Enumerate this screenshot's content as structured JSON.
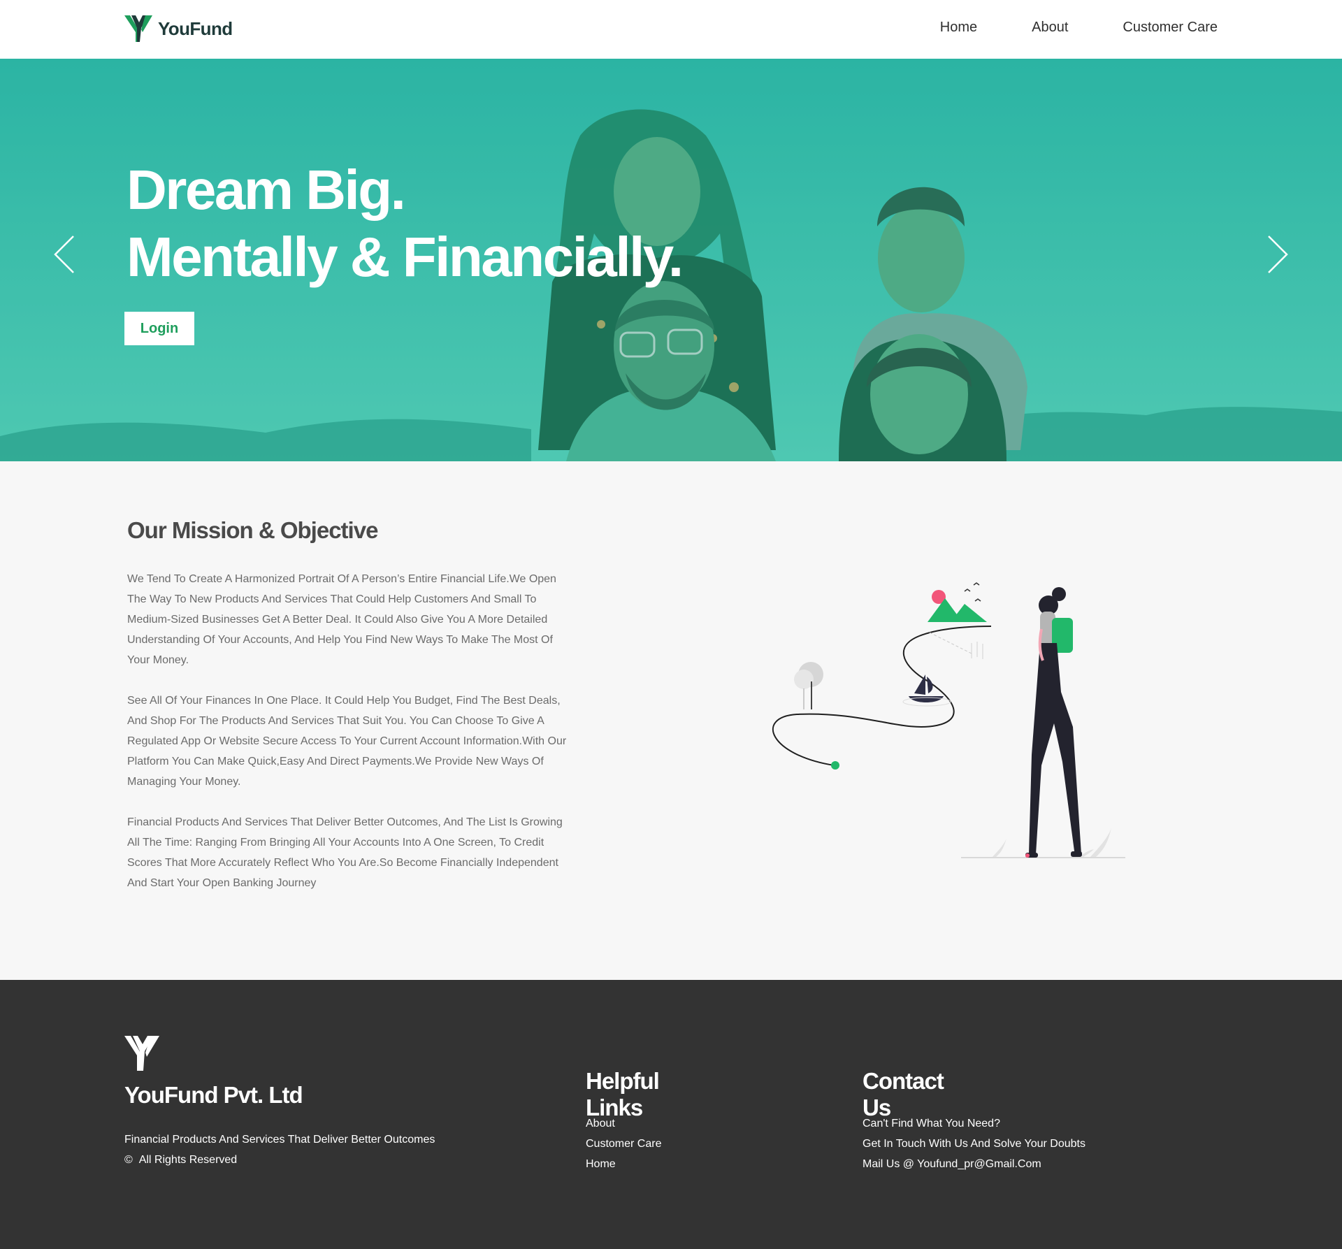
{
  "header": {
    "brand": "YouFund",
    "nav": [
      "Home",
      "About",
      "Customer Care"
    ]
  },
  "hero": {
    "title_line1": "Dream Big.",
    "title_line2": "Mentally & Financially.",
    "login_label": "Login",
    "prev_icon": "chevron-left-icon",
    "next_icon": "chevron-right-icon"
  },
  "mission": {
    "title": "Our Mission & Objective",
    "paragraphs": [
      "We Tend To Create A Harmonized Portrait Of A Person’s Entire Financial Life.We Open The Way To New Products And Services That Could Help Customers And Small To Medium-Sized Businesses Get A Better Deal. It Could Also Give You A More Detailed Understanding Of Your Accounts, And Help You Find New Ways To Make The Most Of Your Money.",
      "See All Of Your Finances In One Place. It Could Help You Budget, Find The Best Deals, And Shop For The Products And Services That Suit You. You Can Choose To Give A Regulated App Or Website Secure Access To Your Current Account Information.With Our Platform You Can Make Quick,Easy And Direct Payments.We Provide New Ways Of Managing Your Money.",
      "Financial Products And Services That Deliver Better Outcomes, And The List Is Growing All The Time: Ranging From Bringing All Your Accounts Into A One Screen, To Credit Scores That More Accurately Reflect Who You Are.So Become Financially Independent And Start Your Open Banking Journey"
    ]
  },
  "footer": {
    "company_name": "YouFund Pvt. Ltd",
    "tagline": "Financial Products And Services That Deliver Better Outcomes",
    "rights_symbol": "©",
    "rights": "All Rights Reserved",
    "links_title": "Helpful Links",
    "links": [
      "About",
      "Customer Care",
      "Home"
    ],
    "contact_title": "Contact Us",
    "contact": [
      "Can't Find What You Need?",
      "Get In Touch With Us And Solve Your Doubts",
      "Mail Us @ Youfund_pr@Gmail.Com"
    ]
  },
  "colors": {
    "brand_green": "#1e9e5c",
    "hero_teal": "#3dbfa9",
    "footer_bg": "#333333",
    "page_bg": "#f7f7f7",
    "illustration_green": "#22b86a",
    "illustration_pink": "#f2567a"
  }
}
